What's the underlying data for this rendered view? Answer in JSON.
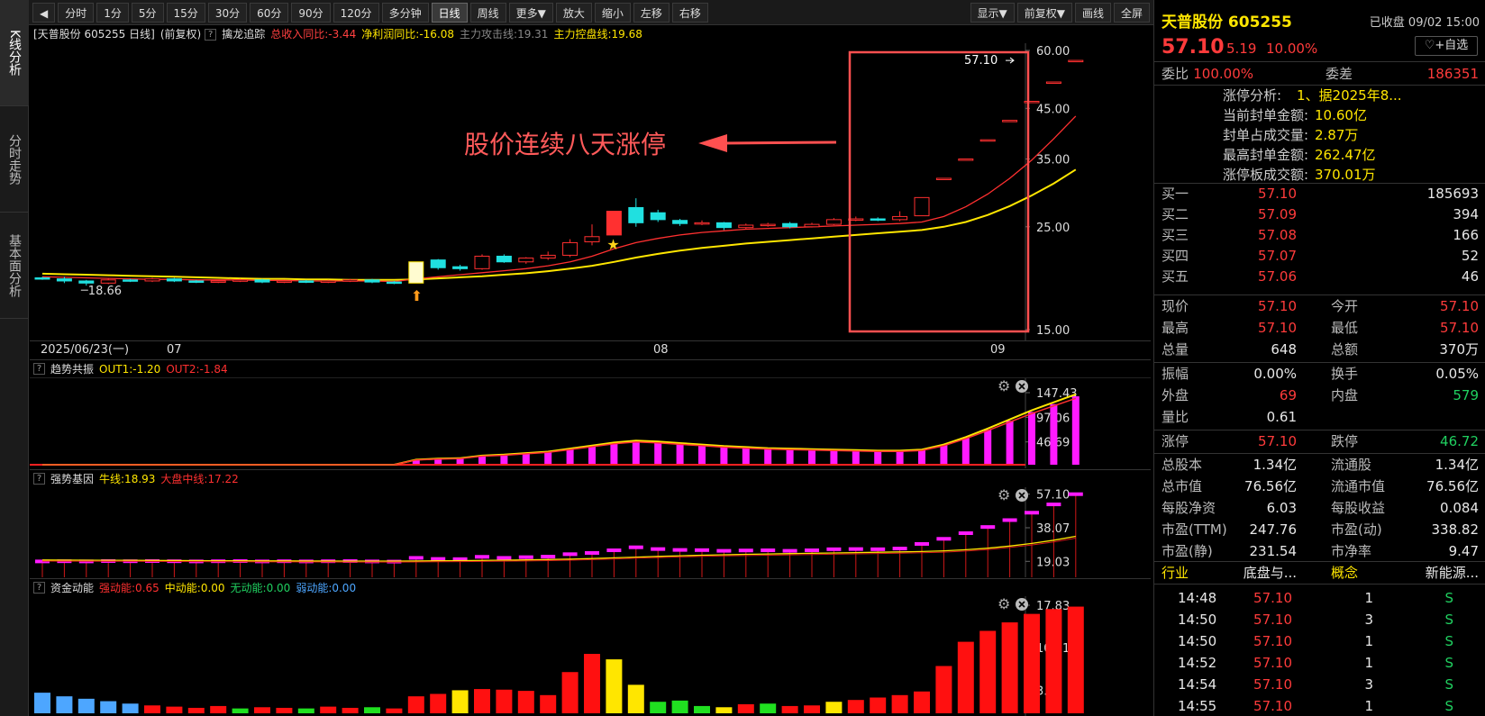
{
  "nav": {
    "kline": "K线分析",
    "fenshi": "分时走势",
    "jiben": "基本面分析"
  },
  "toolbar": {
    "back": "◀",
    "periods": [
      "分时",
      "1分",
      "5分",
      "15分",
      "30分",
      "60分",
      "90分",
      "120分",
      "多分钟",
      "日线",
      "周线",
      "更多▼",
      "放大",
      "缩小",
      "左移",
      "右移"
    ],
    "right": [
      "显示▼",
      "前复权▼",
      "画线",
      "全屏"
    ]
  },
  "main": {
    "title": "[天普股份 605255 日线]",
    "adj": "(前复权)",
    "qmark": "?",
    "ind_name": "擒龙追踪",
    "rev": "总收入同比:-3.44",
    "profit": "净利润同比:-16.08",
    "attack": "主力攻击线:19.31",
    "control": "主力控盘线:19.68",
    "annotation": "股价连续八天涨停",
    "last_label": "57.10",
    "low_label": "18.66",
    "yticks": [
      "60.00",
      "45.00",
      "35.00",
      "25.00",
      "15.00"
    ]
  },
  "xaxis": {
    "date": "2025/06/23(一)",
    "m07": "07",
    "m08": "08",
    "m09": "09"
  },
  "sub1": {
    "name": "趋势共振",
    "out1": "OUT1:-1.20",
    "out2": "OUT2:-1.84",
    "yticks": [
      "147.43",
      "97.06",
      "46.69"
    ]
  },
  "sub2": {
    "name": "强势基因",
    "bull": "牛线:18.93",
    "mid": "大盘中线:17.22",
    "yticks": [
      "57.10",
      "38.07",
      "19.03"
    ]
  },
  "sub3": {
    "name": "资金动能",
    "strong": "强动能:0.65",
    "medium": "中动能:0.00",
    "none": "无动能:0.00",
    "weak": "弱动能:0.00",
    "yticks": [
      "17.83",
      "10.81",
      "3.79"
    ]
  },
  "quote": {
    "name": "天普股份 605255",
    "status": "已收盘 09/02 15:00",
    "price": "57.10",
    "change": "5.19",
    "pct": "10.00%",
    "add": "+自选",
    "webi_l": "委比",
    "webi": "100.00%",
    "weicha_l": "委差",
    "weicha": "186351",
    "zt": [
      [
        "涨停分析:",
        "1、据2025年8..."
      ],
      [
        "当前封单金额:",
        "10.60亿"
      ],
      [
        "封单占成交量:",
        "2.87万"
      ],
      [
        "最高封单金额:",
        "262.47亿"
      ],
      [
        "涨停板成交额:",
        "370.01万"
      ]
    ],
    "bids": [
      [
        "买一",
        "57.10",
        "185693"
      ],
      [
        "买二",
        "57.09",
        "394"
      ],
      [
        "买三",
        "57.08",
        "166"
      ],
      [
        "买四",
        "57.07",
        "52"
      ],
      [
        "买五",
        "57.06",
        "46"
      ]
    ],
    "stats": [
      [
        "现价",
        "57.10",
        "今开",
        "57.10"
      ],
      [
        "最高",
        "57.10",
        "最低",
        "57.10"
      ],
      [
        "总量",
        "648",
        "总额",
        "370万"
      ]
    ],
    "stats2": [
      [
        "振幅",
        "0.00%",
        "换手",
        "0.05%"
      ],
      [
        "外盘",
        "69",
        "内盘",
        "579"
      ],
      [
        "量比",
        "0.61",
        "",
        ""
      ]
    ],
    "limit": [
      "涨停",
      "57.10",
      "跌停",
      "46.72"
    ],
    "fund": [
      [
        "总股本",
        "1.34亿",
        "流通股",
        "1.34亿"
      ],
      [
        "总市值",
        "76.56亿",
        "流通市值",
        "76.56亿"
      ],
      [
        "每股净资",
        "6.03",
        "每股收益",
        "0.084"
      ],
      [
        "市盈(TTM)",
        "247.76",
        "市盈(动)",
        "338.82"
      ],
      [
        "市盈(静)",
        "231.54",
        "市净率",
        "9.47"
      ]
    ],
    "industry": [
      "行业",
      "底盘与...",
      "概念",
      "新能源..."
    ],
    "ticks": [
      [
        "14:48",
        "57.10",
        "1",
        "S"
      ],
      [
        "14:50",
        "57.10",
        "3",
        "S"
      ],
      [
        "14:50",
        "57.10",
        "1",
        "S"
      ],
      [
        "14:52",
        "57.10",
        "1",
        "S"
      ],
      [
        "14:54",
        "57.10",
        "3",
        "S"
      ],
      [
        "14:55",
        "57.10",
        "1",
        "S"
      ]
    ]
  },
  "chart_data": {
    "type": "candlestick",
    "candles": [
      [
        19.4,
        19.3,
        19.5,
        19.2
      ],
      [
        19.3,
        19.1,
        19.5,
        18.9
      ],
      [
        19.1,
        18.9,
        19.2,
        18.66
      ],
      [
        18.9,
        19.2,
        19.4,
        18.8
      ],
      [
        19.2,
        19.1,
        19.3,
        19.0
      ],
      [
        19.1,
        19.3,
        19.4,
        19.0
      ],
      [
        19.3,
        19.1,
        19.4,
        19.0
      ],
      [
        19.1,
        19.0,
        19.2,
        18.9
      ],
      [
        19.0,
        19.1,
        19.2,
        18.9
      ],
      [
        19.1,
        19.2,
        19.3,
        19.0
      ],
      [
        19.2,
        19.0,
        19.3,
        18.9
      ],
      [
        19.0,
        19.1,
        19.2,
        18.9
      ],
      [
        19.1,
        19.0,
        19.2,
        18.9
      ],
      [
        19.0,
        19.1,
        19.2,
        18.9
      ],
      [
        19.1,
        19.2,
        19.3,
        19.0
      ],
      [
        19.2,
        19.0,
        19.3,
        18.9
      ],
      [
        19.0,
        18.9,
        19.1,
        18.8
      ],
      [
        18.9,
        21.0,
        21.0,
        18.9
      ],
      [
        21.2,
        20.4,
        21.3,
        20.2
      ],
      [
        20.5,
        20.3,
        20.7,
        20.1
      ],
      [
        20.3,
        21.6,
        21.8,
        20.2
      ],
      [
        21.6,
        21.0,
        21.8,
        20.9
      ],
      [
        21.0,
        21.4,
        21.5,
        20.8
      ],
      [
        21.4,
        21.7,
        22.1,
        21.2
      ],
      [
        21.7,
        23.1,
        23.5,
        21.5
      ],
      [
        23.2,
        23.8,
        25.3,
        22.8
      ],
      [
        24.0,
        27.0,
        27.0,
        24.0
      ],
      [
        27.5,
        25.5,
        28.8,
        25.0
      ],
      [
        26.8,
        25.9,
        27.2,
        25.6
      ],
      [
        25.8,
        25.4,
        26.0,
        25.1
      ],
      [
        25.4,
        25.5,
        25.8,
        25.2
      ],
      [
        25.5,
        24.9,
        25.6,
        24.6
      ],
      [
        24.9,
        25.2,
        25.4,
        24.7
      ],
      [
        25.2,
        25.3,
        25.5,
        25.0
      ],
      [
        25.4,
        25.0,
        25.6,
        24.8
      ],
      [
        25.0,
        25.3,
        25.5,
        24.9
      ],
      [
        25.3,
        25.9,
        26.1,
        25.2
      ],
      [
        25.9,
        26.0,
        26.3,
        25.7
      ],
      [
        26.0,
        25.9,
        26.2,
        25.7
      ],
      [
        25.9,
        26.3,
        27.0,
        25.7
      ],
      [
        26.4,
        28.9,
        28.9,
        26.4
      ],
      [
        31.8,
        31.8,
        31.8,
        31.8
      ],
      [
        35.0,
        35.0,
        35.0,
        35.0
      ],
      [
        38.5,
        38.5,
        38.5,
        38.5
      ],
      [
        42.4,
        42.4,
        42.4,
        42.4
      ],
      [
        46.6,
        46.6,
        46.6,
        46.6
      ],
      [
        51.3,
        51.3,
        51.3,
        51.3
      ],
      [
        57.1,
        57.1,
        57.1,
        57.1
      ]
    ],
    "ma_fast": [
      19.5,
      19.45,
      19.4,
      19.35,
      19.3,
      19.25,
      19.25,
      19.2,
      19.2,
      19.2,
      19.15,
      19.15,
      19.1,
      19.1,
      19.1,
      19.1,
      19.05,
      19.3,
      19.5,
      19.7,
      19.9,
      20.1,
      20.3,
      20.6,
      21.0,
      21.6,
      22.4,
      23.1,
      23.6,
      24.0,
      24.3,
      24.5,
      24.7,
      24.8,
      24.9,
      25.0,
      25.1,
      25.2,
      25.3,
      25.4,
      25.6,
      26.3,
      27.6,
      29.4,
      31.8,
      34.8,
      38.7,
      43.3
    ],
    "ma_slow": [
      19.8,
      19.75,
      19.7,
      19.65,
      19.6,
      19.55,
      19.5,
      19.45,
      19.4,
      19.35,
      19.3,
      19.3,
      19.25,
      19.25,
      19.2,
      19.2,
      19.2,
      19.25,
      19.35,
      19.45,
      19.55,
      19.7,
      19.85,
      20.05,
      20.3,
      20.6,
      21.0,
      21.45,
      21.85,
      22.2,
      22.5,
      22.75,
      23.0,
      23.2,
      23.4,
      23.6,
      23.8,
      24.0,
      24.2,
      24.4,
      24.6,
      25.0,
      25.6,
      26.5,
      27.7,
      29.2,
      31.0,
      33.2
    ],
    "sub1_bars": [
      0,
      0,
      0,
      0,
      0,
      0,
      0,
      0,
      0,
      0,
      0,
      0,
      0,
      0,
      0,
      0,
      0,
      10,
      12,
      13,
      18,
      20,
      23,
      26,
      32,
      38,
      44,
      48,
      46,
      43,
      40,
      37,
      35,
      33,
      32,
      31,
      30,
      29,
      28,
      28,
      30,
      40,
      55,
      72,
      90,
      108,
      124,
      140
    ],
    "sub2_bars": [
      19.0,
      19.1,
      19.0,
      19.2,
      19.1,
      19.2,
      19.1,
      19.0,
      19.1,
      19.2,
      19.0,
      19.1,
      19.0,
      19.1,
      19.2,
      19.0,
      18.9,
      21.0,
      20.4,
      20.3,
      21.6,
      21.0,
      21.4,
      21.7,
      23.1,
      23.8,
      25.3,
      27.0,
      26.0,
      25.5,
      25.4,
      25.0,
      25.2,
      25.3,
      25.0,
      25.3,
      25.9,
      26.0,
      25.9,
      26.3,
      28.9,
      31.8,
      35.0,
      38.5,
      42.4,
      46.6,
      51.3,
      57.1
    ],
    "sub3_bars": [
      3.4,
      2.8,
      2.4,
      2.0,
      1.6,
      1.3,
      1.1,
      0.9,
      1.2,
      0.8,
      1.0,
      0.9,
      0.8,
      1.1,
      0.9,
      1.0,
      0.8,
      2.8,
      3.2,
      3.8,
      4.0,
      3.9,
      3.7,
      3.0,
      6.8,
      9.8,
      8.9,
      4.7,
      1.9,
      2.1,
      1.2,
      1.0,
      1.5,
      1.6,
      1.2,
      1.3,
      1.9,
      2.2,
      2.6,
      3.0,
      3.6,
      7.8,
      11.8,
      13.6,
      15.0,
      16.4,
      17.2,
      17.6
    ]
  }
}
